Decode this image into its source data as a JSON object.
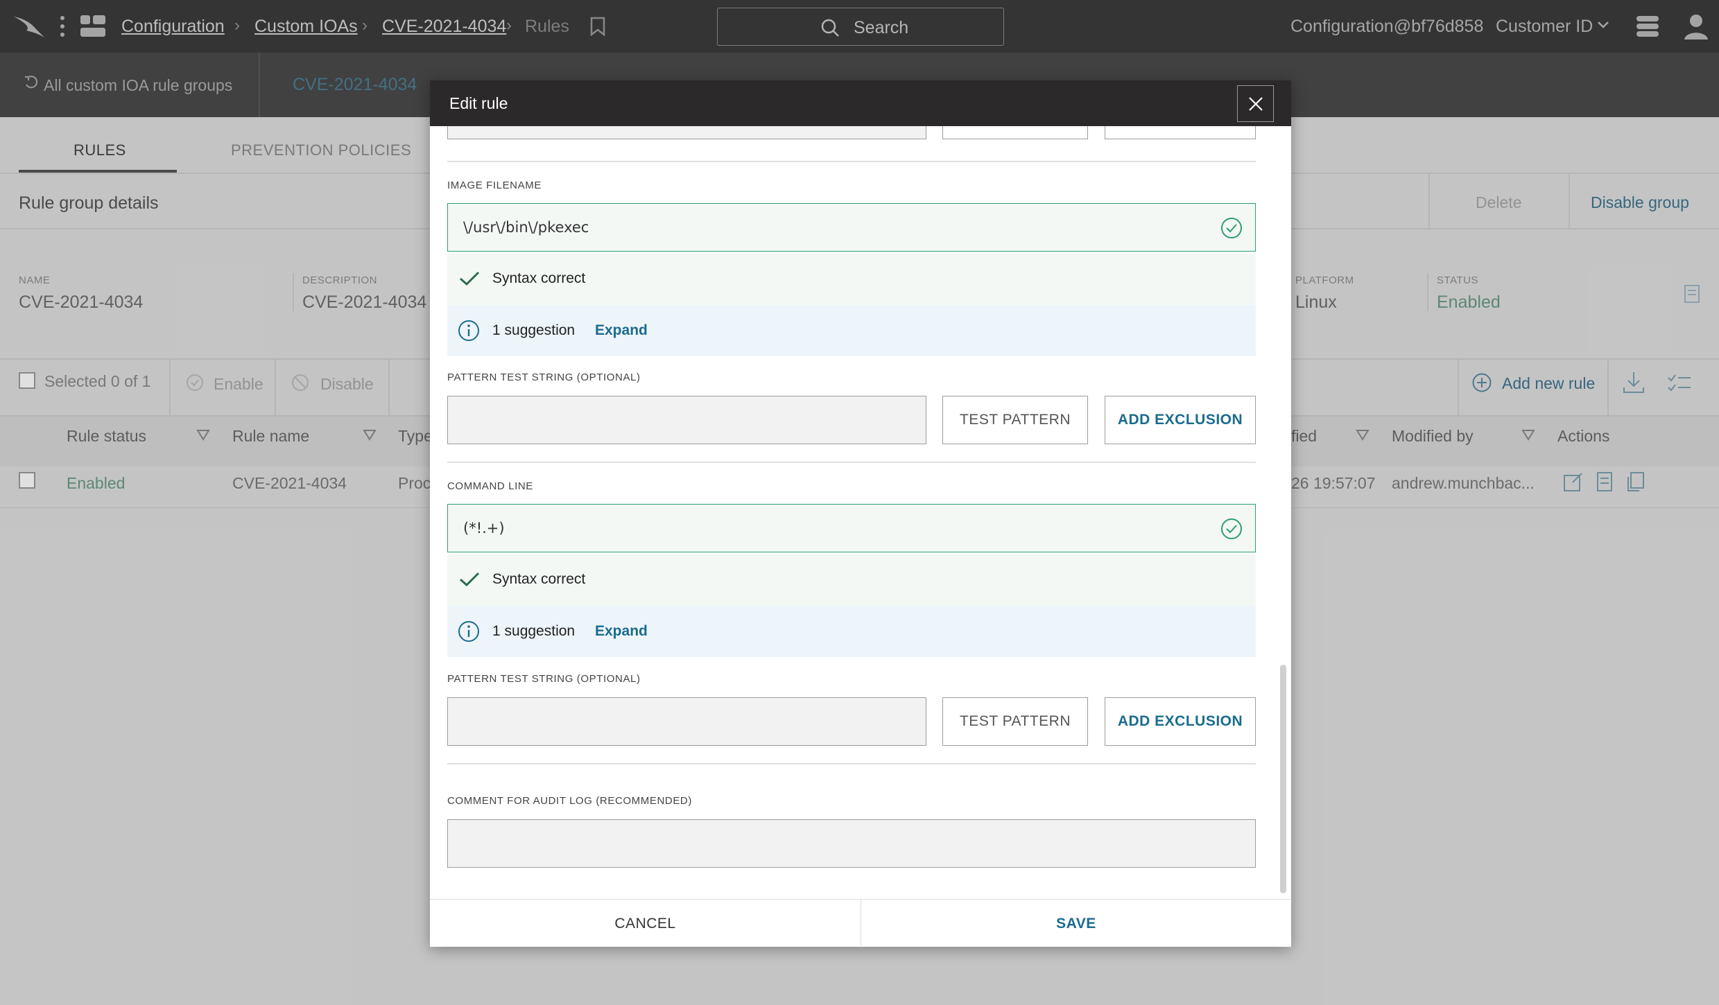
{
  "topbar": {
    "breadcrumb": [
      "Configuration",
      "Custom IOAs",
      "CVE-2021-4034",
      "Rules"
    ],
    "search_placeholder": "Search",
    "account": "Configuration@bf76d858",
    "customer_id": "Customer ID"
  },
  "subheader": {
    "back_link": "All custom IOA rule groups",
    "group_title": "CVE-2021-4034"
  },
  "page": {
    "tabs": [
      "RULES",
      "PREVENTION POLICIES"
    ],
    "section_title": "Rule group details",
    "delete_label": "Delete",
    "disable_group_label": "Disable group",
    "details": {
      "name_label": "NAME",
      "name_value": "CVE-2021-4034",
      "description_label": "DESCRIPTION",
      "description_value": "CVE-2021-4034",
      "platform_label": "PLATFORM",
      "platform_value": "Linux",
      "status_label": "STATUS",
      "status_value": "Enabled"
    },
    "toolbar": {
      "selected": "Selected 0 of 1",
      "enable": "Enable",
      "disable": "Disable",
      "add_new_rule": "Add new rule"
    },
    "table": {
      "columns": [
        "Rule status",
        "Rule name",
        "Type",
        "fied",
        "Modified by",
        "Actions"
      ],
      "row": {
        "status": "Enabled",
        "name": "CVE-2021-4034",
        "type": "Proc",
        "modified": "26 19:57:07",
        "modified_by": "andrew.munchbac..."
      }
    }
  },
  "modal": {
    "title": "Edit rule",
    "image_filename": {
      "label": "IMAGE FILENAME",
      "value": "\\/usr\\/bin\\/pkexec",
      "syntax_status": "Syntax correct",
      "suggestion_text": "1 suggestion",
      "expand_label": "Expand",
      "test_string_label": "PATTERN TEST STRING (OPTIONAL)",
      "test_button": "TEST PATTERN",
      "exclusion_button": "ADD EXCLUSION"
    },
    "command_line": {
      "label": "COMMAND LINE",
      "value": "(*!.+)",
      "syntax_status": "Syntax correct",
      "suggestion_text": "1 suggestion",
      "expand_label": "Expand",
      "test_string_label": "PATTERN TEST STRING (OPTIONAL)",
      "test_button": "TEST PATTERN",
      "exclusion_button": "ADD EXCLUSION"
    },
    "comment_label": "COMMENT FOR AUDIT LOG (RECOMMENDED)",
    "cancel_label": "CANCEL",
    "save_label": "SAVE"
  },
  "colors": {
    "accent": "#1a6c8c",
    "success": "#2e9e6e",
    "header": "#2b2929"
  }
}
